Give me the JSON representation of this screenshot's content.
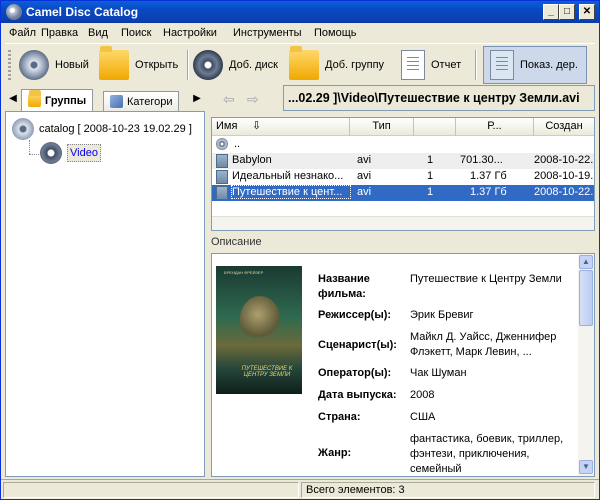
{
  "window": {
    "title": "Camel Disc Catalog"
  },
  "menu": [
    "Файл",
    "Правка",
    "Вид",
    "Поиск",
    "Настройки",
    "Инструменты",
    "Помощь"
  ],
  "toolbar": {
    "new_label": "Новый",
    "open_label": "Открыть",
    "add_disc_label": "Доб. диск",
    "add_group_label": "Доб. группу",
    "report_label": "Отчет",
    "show_tree_label": "Показ. дер."
  },
  "left_tabs": {
    "groups": "Группы",
    "categories": "Категори"
  },
  "tree": {
    "root": "catalog [ 2008-10-23 19.02.29 ]",
    "child": "Video"
  },
  "path": "...02.29 ]\\Video\\Путешествие к центру Земли.avi",
  "filelist": {
    "columns": {
      "name": "Имя",
      "type": "Тип",
      "count": "",
      "size": "Р...",
      "created": "Создан"
    },
    "rows": [
      {
        "name": "..",
        "type": "",
        "count": "",
        "size": "",
        "created": "",
        "icon": "disc"
      },
      {
        "name": "Babylon",
        "type": "avi",
        "count": "1",
        "size": "701.30...",
        "created": "2008-10-22...",
        "icon": "file"
      },
      {
        "name": "Идеальный незнако...",
        "type": "avi",
        "count": "1",
        "size": "1.37 Гб",
        "created": "2008-10-19...",
        "icon": "file"
      },
      {
        "name": "Путешествие к цент...",
        "type": "avi",
        "count": "1",
        "size": "1.37 Гб",
        "created": "2008-10-22...",
        "icon": "file",
        "selected": true
      }
    ]
  },
  "description": {
    "label": "Описание",
    "poster": {
      "top_text": "БРЕНДАН ФРЕЙЗЕР",
      "title": "ПУТЕШЕСТВИЕ К ЦЕНТРУ ЗЕМЛИ"
    },
    "fields": [
      {
        "key": "Название фильма:",
        "value": "Путешествие к Центру Земли"
      },
      {
        "key": "Режиссер(ы):",
        "value": "Эрик Бревиг"
      },
      {
        "key": "Сценарист(ы):",
        "value": "Майкл Д. Уайсс, Дженнифер Флэкетт, Марк Левин, ..."
      },
      {
        "key": "Оператор(ы):",
        "value": "Чак Шуман"
      },
      {
        "key": "Дата выпуска:",
        "value": "2008"
      },
      {
        "key": "Страна:",
        "value": "США"
      },
      {
        "key": "Жанр:",
        "value": "фантастика, боевик, триллер, фэнтези, приключения, семейный"
      }
    ]
  },
  "status": {
    "total": "Всего элементов: 3"
  }
}
